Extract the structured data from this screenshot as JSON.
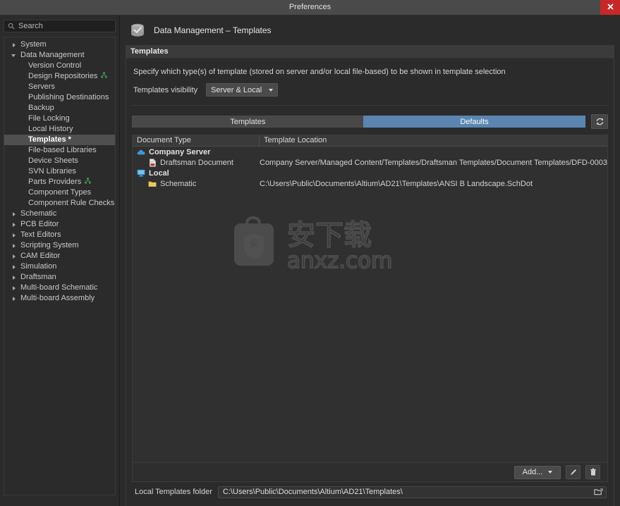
{
  "window": {
    "title": "Preferences",
    "close_label": "✕"
  },
  "sidebar": {
    "search": {
      "placeholder": "Search",
      "value": "",
      "icon": "search-icon"
    },
    "items": [
      {
        "label": "System",
        "level": 1,
        "state": "collapsed",
        "selected": false,
        "badge": ""
      },
      {
        "label": "Data Management",
        "level": 1,
        "state": "expanded",
        "selected": false,
        "badge": ""
      },
      {
        "label": "Version Control",
        "level": 2,
        "state": "leaf",
        "selected": false,
        "badge": ""
      },
      {
        "label": "Design Repositories",
        "level": 2,
        "state": "leaf",
        "selected": false,
        "badge": "network-icon"
      },
      {
        "label": "Servers",
        "level": 2,
        "state": "leaf",
        "selected": false,
        "badge": ""
      },
      {
        "label": "Publishing Destinations",
        "level": 2,
        "state": "leaf",
        "selected": false,
        "badge": ""
      },
      {
        "label": "Backup",
        "level": 2,
        "state": "leaf",
        "selected": false,
        "badge": ""
      },
      {
        "label": "File Locking",
        "level": 2,
        "state": "leaf",
        "selected": false,
        "badge": ""
      },
      {
        "label": "Local History",
        "level": 2,
        "state": "leaf",
        "selected": false,
        "badge": ""
      },
      {
        "label": "Templates *",
        "level": 2,
        "state": "leaf",
        "selected": true,
        "badge": ""
      },
      {
        "label": "File-based Libraries",
        "level": 2,
        "state": "leaf",
        "selected": false,
        "badge": ""
      },
      {
        "label": "Device Sheets",
        "level": 2,
        "state": "leaf",
        "selected": false,
        "badge": ""
      },
      {
        "label": "SVN Libraries",
        "level": 2,
        "state": "leaf",
        "selected": false,
        "badge": ""
      },
      {
        "label": "Parts Providers",
        "level": 2,
        "state": "leaf",
        "selected": false,
        "badge": "network-icon"
      },
      {
        "label": "Component Types",
        "level": 2,
        "state": "leaf",
        "selected": false,
        "badge": ""
      },
      {
        "label": "Component Rule Checks",
        "level": 2,
        "state": "leaf",
        "selected": false,
        "badge": ""
      },
      {
        "label": "Schematic",
        "level": 1,
        "state": "collapsed",
        "selected": false,
        "badge": ""
      },
      {
        "label": "PCB Editor",
        "level": 1,
        "state": "collapsed",
        "selected": false,
        "badge": ""
      },
      {
        "label": "Text Editors",
        "level": 1,
        "state": "collapsed",
        "selected": false,
        "badge": ""
      },
      {
        "label": "Scripting System",
        "level": 1,
        "state": "collapsed",
        "selected": false,
        "badge": ""
      },
      {
        "label": "CAM Editor",
        "level": 1,
        "state": "collapsed",
        "selected": false,
        "badge": ""
      },
      {
        "label": "Simulation",
        "level": 1,
        "state": "collapsed",
        "selected": false,
        "badge": ""
      },
      {
        "label": "Draftsman",
        "level": 1,
        "state": "collapsed",
        "selected": false,
        "badge": ""
      },
      {
        "label": "Multi-board Schematic",
        "level": 1,
        "state": "collapsed",
        "selected": false,
        "badge": ""
      },
      {
        "label": "Multi-board Assembly",
        "level": 1,
        "state": "collapsed",
        "selected": false,
        "badge": ""
      }
    ]
  },
  "page": {
    "title": "Data Management – Templates",
    "icon": "database-check-icon"
  },
  "section": {
    "header": "Templates",
    "description": "Specify which type(s) of template (stored on server and/or local file-based) to be shown in template selection",
    "visibility": {
      "label": "Templates visibility",
      "value": "Server & Local"
    }
  },
  "tabs": [
    {
      "label": "Templates",
      "active": false
    },
    {
      "label": "Defaults",
      "active": true
    }
  ],
  "refresh": {
    "icon": "refresh-icon",
    "tooltip": "Refresh"
  },
  "table": {
    "columns": [
      "Document Type",
      "Template Location"
    ],
    "rows": [
      {
        "type": "group",
        "icon": "cloud-icon",
        "document_type": "Company Server",
        "template_location": ""
      },
      {
        "type": "child",
        "icon": "draftsman-document-icon",
        "document_type": "Draftsman Document",
        "template_location": "Company Server/Managed Content/Templates/Draftsman Templates/Document Templates/DFD-0003"
      },
      {
        "type": "group",
        "icon": "monitor-icon",
        "document_type": "Local",
        "template_location": ""
      },
      {
        "type": "child",
        "icon": "folder-icon",
        "document_type": "Schematic",
        "template_location": "C:\\Users\\Public\\Documents\\Altium\\AD21\\Templates\\ANSI B Landscape.SchDot"
      }
    ]
  },
  "watermark": {
    "cn_text": "安下载",
    "domain_text": "anxz.com",
    "shield_char": "安"
  },
  "toolbar": {
    "add_label": "Add...",
    "edit_icon": "pencil-icon",
    "delete_icon": "trash-icon"
  },
  "folder": {
    "label": "Local Templates folder",
    "value": "C:\\Users\\Public\\Documents\\Altium\\AD21\\Templates\\",
    "browse_icon": "folder-open-icon"
  },
  "colors": {
    "accent_blue": "#5b85b0",
    "close_red": "#c62828",
    "cloud_blue": "#3d9ad8",
    "folder_yellow": "#d8ae45",
    "badge_green": "#3fa34a",
    "selected_row": "#4f4f4f"
  }
}
